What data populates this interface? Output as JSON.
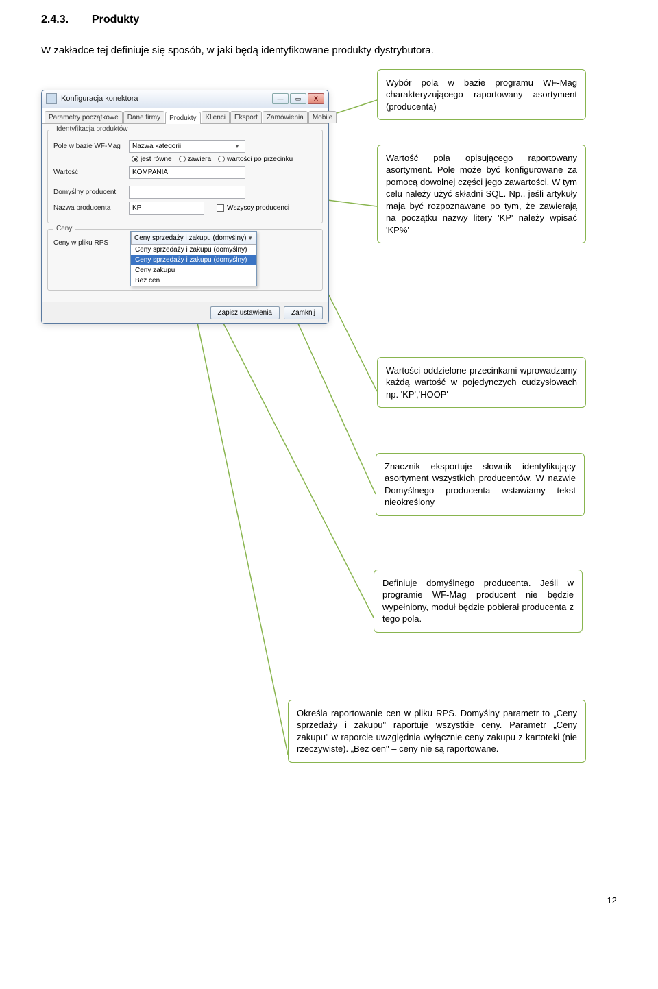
{
  "section": {
    "num": "2.4.3.",
    "title": "Produkty"
  },
  "intro": "W zakładce tej definiuje się sposób, w jaki będą identyfikowane produkty dystrybutora.",
  "dialog": {
    "title": "Konfiguracja konektora",
    "winbtns": {
      "min": "—",
      "max": "▭",
      "close": "X"
    },
    "tabs": [
      "Parametry początkowe",
      "Dane firmy",
      "Produkty",
      "Klienci",
      "Eksport",
      "Zamówienia",
      "Mobile"
    ],
    "active_tab": "Produkty",
    "group1_title": "Identyfikacja produktów",
    "lbl_pole": "Pole w bazie WF-Mag",
    "combo_pole": "Nazwa kategorii",
    "radio1": "jest równe",
    "radio2": "zawiera",
    "radio3": "wartości po przecinku",
    "lbl_wartosc": "Wartość",
    "txt_wartosc": "KOMPANIA",
    "lbl_domyslny": "Domyślny producent",
    "lbl_nazwa": "Nazwa producenta",
    "txt_nazwa": "KP",
    "chk_all": "Wszyscy producenci",
    "group2_title": "Ceny",
    "lbl_ceny": "Ceny w pliku RPS",
    "dd_head": "Ceny sprzedaży i zakupu (domyślny)",
    "dd_items": [
      "Ceny sprzedaży i zakupu (domyślny)",
      "Ceny sprzedaży i zakupu (domyślny)",
      "Ceny zakupu",
      "Bez cen"
    ],
    "btn_save": "Zapisz ustawienia",
    "btn_close": "Zamknij"
  },
  "callouts": {
    "c1": "Wybór pola w bazie programu WF-Mag charakteryzującego raportowany asortyment (producenta)",
    "c2": "Wartość pola opisującego raportowany asortyment. Pole może być konfigurowane za pomocą dowolnej części jego zawartości. W tym celu należy użyć składni SQL. Np., jeśli artykuły maja być rozpoznawane po tym, że zawierają na początku nazwy litery 'KP' należy wpisać 'KP%'",
    "c3": "Wartości oddzielone przecinkami wprowadzamy każdą wartość w pojedynczych cudzysłowach np. 'KP','HOOP'",
    "c4": "Znacznik eksportuje słownik identyfikujący asortyment wszystkich producentów. W nazwie Domyślnego producenta wstawiamy tekst nieokreślony",
    "c5": "Definiuje domyślnego producenta. Jeśli w programie WF-Mag producent nie będzie wypełniony, moduł będzie pobierał producenta z tego pola.",
    "c6": "Określa raportowanie cen w pliku RPS.\nDomyślny parametr to „Ceny sprzedaży i zakupu\" raportuje wszystkie ceny. Parametr „Ceny zakupu\" w raporcie uwzględnia wyłącznie ceny zakupu z kartoteki (nie rzeczywiste). „Bez cen\" – ceny nie są raportowane."
  },
  "pagenum": "12"
}
